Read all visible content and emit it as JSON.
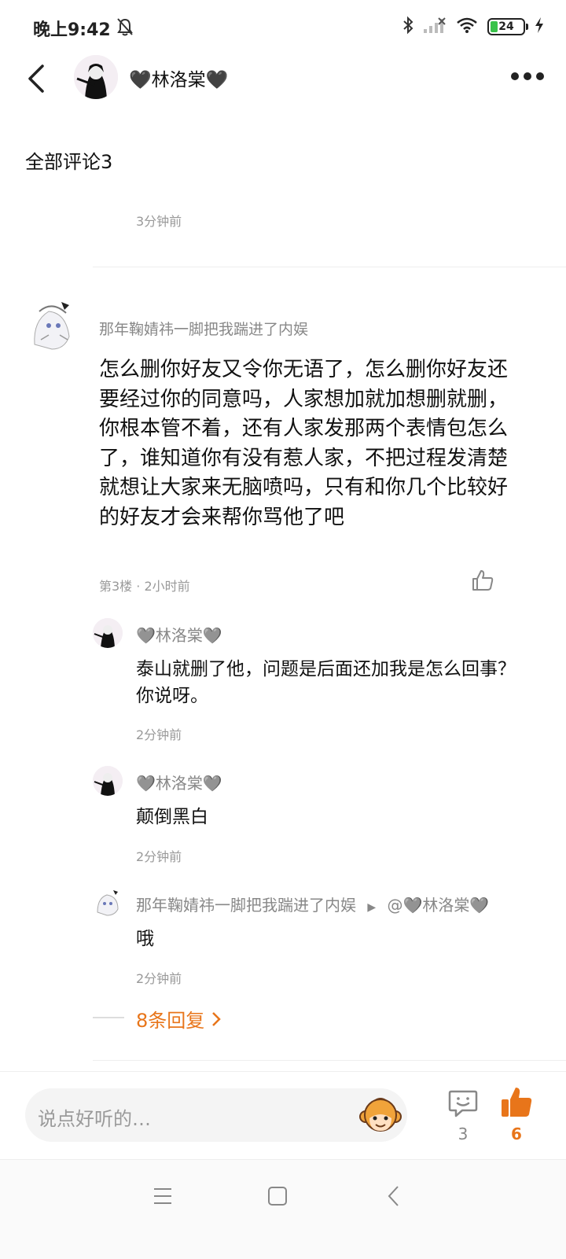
{
  "status_bar": {
    "time": "晚上9:42",
    "battery": "24"
  },
  "header": {
    "username": "🖤林洛棠🖤"
  },
  "comments_section": {
    "title": "全部评论3",
    "prev_time": "3分钟前"
  },
  "main_comment": {
    "username": "那年鞠婧祎一脚把我踹进了内娱",
    "text": "怎么删你好友又令你无语了，怎么删你好友还要经过你的同意吗，人家想加就加想删就删，你根本管不着，还有人家发那两个表情包怎么了，谁知道你有没有惹人家，不把过程发清楚就想让大家来无脑喷吗，只有和你几个比较好的好友才会来帮你骂他了吧",
    "meta": "第3楼 · 2小时前"
  },
  "replies": [
    {
      "username": "🩶林洛棠🩶",
      "text": "泰山就删了他，问题是后面还加我是怎么回事？你说呀。",
      "time": "2分钟前"
    },
    {
      "username": "🩶林洛棠🩶",
      "text": "颠倒黑白",
      "time": "2分钟前"
    },
    {
      "username": "那年鞠婧祎一脚把我踹进了内娱",
      "reply_to": "@🩶林洛棠🩶",
      "text": "哦",
      "time": "2分钟前"
    }
  ],
  "more_replies": "8条回复",
  "bottom_bar": {
    "placeholder": "说点好听的…",
    "comment_count": "3",
    "like_count": "6"
  },
  "colors": {
    "accent": "#e8751a",
    "battery_green": "#39c24a"
  }
}
